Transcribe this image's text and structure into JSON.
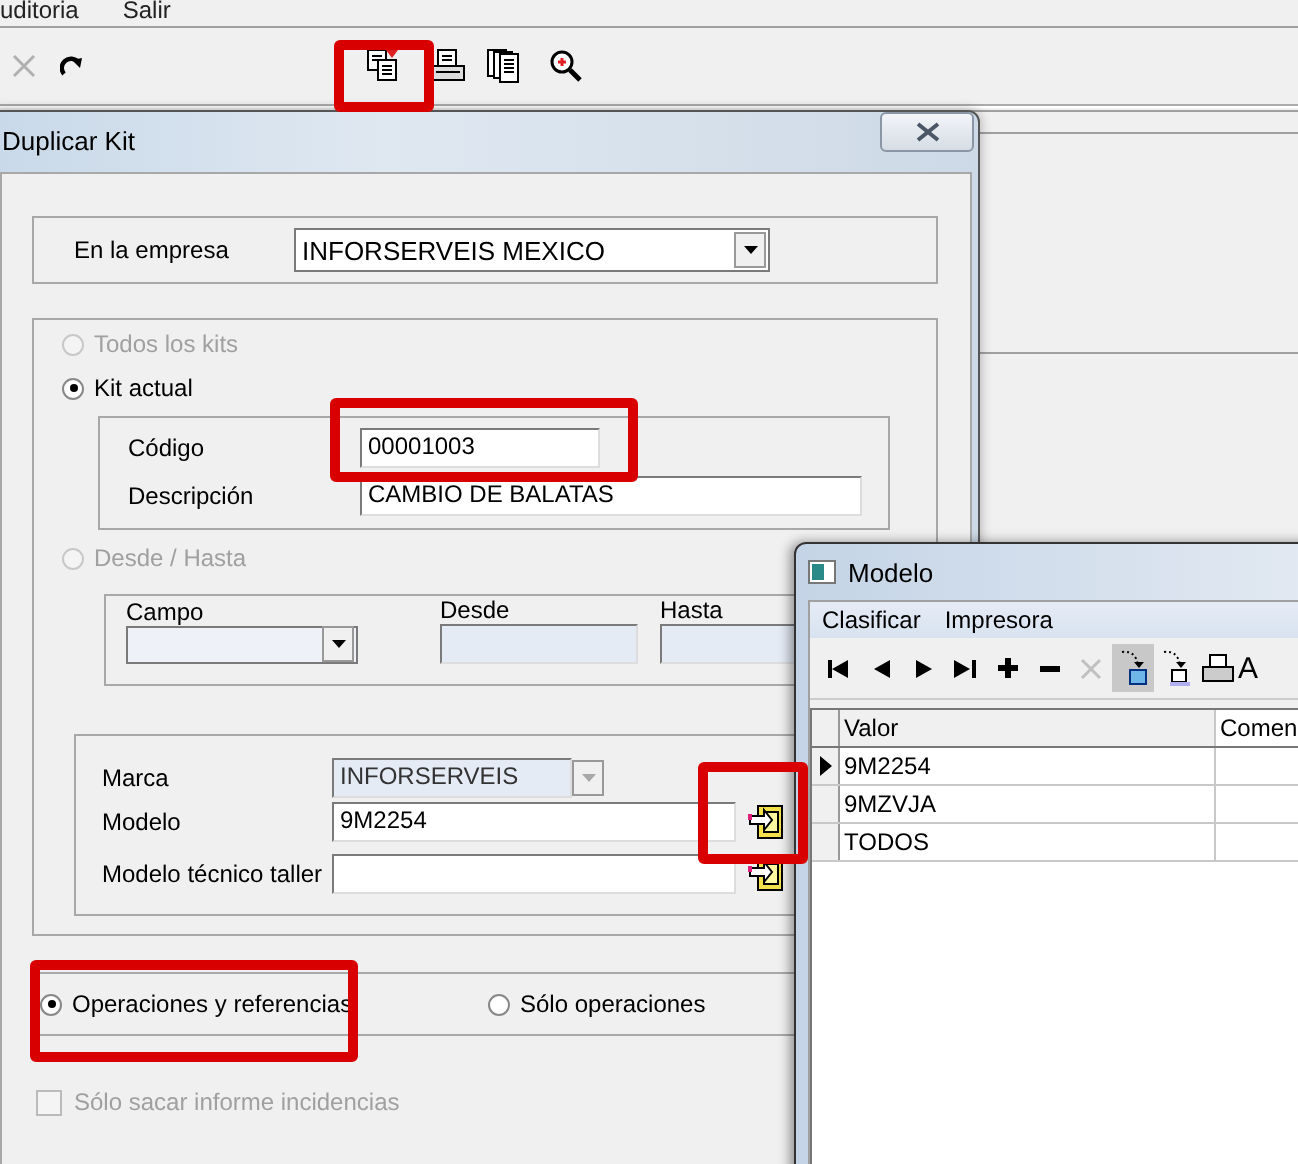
{
  "menu": [
    {
      "label": "uditoria"
    },
    {
      "label": "Salir"
    }
  ],
  "toolbar": [
    {
      "kind": "cancel",
      "disabled": true
    },
    {
      "kind": "redo",
      "disabled": false
    },
    {
      "kind": "duplicate",
      "disabled": false
    },
    {
      "kind": "print",
      "disabled": false
    },
    {
      "kind": "pages",
      "disabled": false
    },
    {
      "kind": "zoom",
      "disabled": false
    }
  ],
  "dialog": {
    "title": "Duplicar Kit",
    "company": {
      "label": "En la empresa",
      "value": "INFORSERVEIS MEXICO"
    },
    "scope_options": [
      {
        "label": "Todos los kits",
        "selected": false,
        "disabled": true
      },
      {
        "label": "Kit actual",
        "selected": true,
        "disabled": false
      },
      {
        "label": "Desde / Hasta",
        "selected": false,
        "disabled": true
      }
    ],
    "current_kit": {
      "code_label": "Código",
      "code": "00001003",
      "description_label": "Descripción",
      "description": "CAMBIO DE BALATAS"
    },
    "range": {
      "field_label": "Campo",
      "from_label": "Desde",
      "to_label": "Hasta"
    },
    "model_fields": [
      {
        "kind": "dropdown",
        "label": "Marca",
        "value": "INFORSERVEIS",
        "disabled": true
      },
      {
        "kind": "lookup",
        "label": "Modelo",
        "value": "9M2254"
      },
      {
        "kind": "lookup",
        "label": "Modelo técnico taller"
      }
    ],
    "copy_options": [
      {
        "label": "Operaciones y referencias",
        "selected": true
      },
      {
        "label": "Sólo operaciones",
        "selected": false
      }
    ],
    "incidents_checkbox": {
      "label": "Sólo sacar informe incidencias",
      "checked": false,
      "disabled": true
    }
  },
  "lookup_window": {
    "title": "Modelo",
    "menu": [
      "Clasificar",
      "Impresora"
    ],
    "toolbar": [
      {
        "kind": "first",
        "disabled": false,
        "pressed": false
      },
      {
        "kind": "prev",
        "disabled": false,
        "pressed": false
      },
      {
        "kind": "next",
        "disabled": false,
        "pressed": false
      },
      {
        "kind": "last",
        "disabled": false,
        "pressed": false
      },
      {
        "kind": "add",
        "disabled": false,
        "pressed": false
      },
      {
        "kind": "remove",
        "disabled": false,
        "pressed": false
      },
      {
        "kind": "cancel",
        "disabled": true,
        "pressed": false
      },
      {
        "kind": "filter",
        "disabled": false,
        "pressed": true
      },
      {
        "kind": "unfilter",
        "disabled": false,
        "pressed": false
      },
      {
        "kind": "print",
        "disabled": false,
        "pressed": false
      },
      {
        "kind": "font",
        "label": "A",
        "disabled": false,
        "pressed": false
      }
    ],
    "columns": [
      "Valor",
      "Comen"
    ],
    "rows": [
      {
        "cells": [
          "9M2254"
        ],
        "selected": true
      },
      {
        "cells": [
          "9MZVJA"
        ],
        "selected": false
      },
      {
        "cells": [
          "TODOS"
        ],
        "selected": false
      }
    ]
  }
}
